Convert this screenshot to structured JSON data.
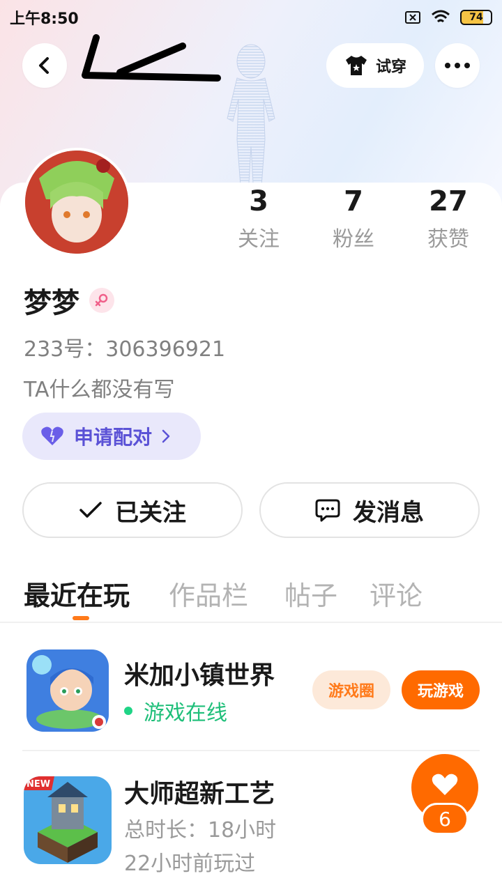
{
  "status_bar": {
    "time": "上午8:50",
    "battery": "74"
  },
  "header": {
    "try_on_label": "试穿"
  },
  "profile": {
    "name": "梦梦",
    "uid": "233号：306396921",
    "bio": "TA什么都没有写",
    "match_label": "申请配对"
  },
  "stats": [
    {
      "value": "3",
      "label": "关注"
    },
    {
      "value": "7",
      "label": "粉丝"
    },
    {
      "value": "27",
      "label": "获赞"
    }
  ],
  "actions": {
    "followed_label": "已关注",
    "message_label": "发消息"
  },
  "tabs": [
    {
      "label": "最近在玩",
      "active": true
    },
    {
      "label": "作品栏",
      "active": false
    },
    {
      "label": "帖子",
      "active": false
    },
    {
      "label": "评论",
      "active": false
    }
  ],
  "games": [
    {
      "title": "米加小镇世界",
      "status": "游戏在线",
      "circle_label": "游戏圈",
      "play_label": "玩游戏"
    },
    {
      "title": "大师超新工艺",
      "duration": "总时长：18小时",
      "last_played": "22小时前玩过"
    }
  ],
  "floating": {
    "like_count": "6"
  },
  "colors": {
    "accent": "#ff6a00",
    "online": "#1fbf7a",
    "match": "#5b52d6"
  },
  "icons": [
    "back-icon",
    "tshirt-icon",
    "more-icon",
    "female-icon",
    "heart-icon",
    "chevron-right-icon",
    "check-icon",
    "message-icon"
  ]
}
